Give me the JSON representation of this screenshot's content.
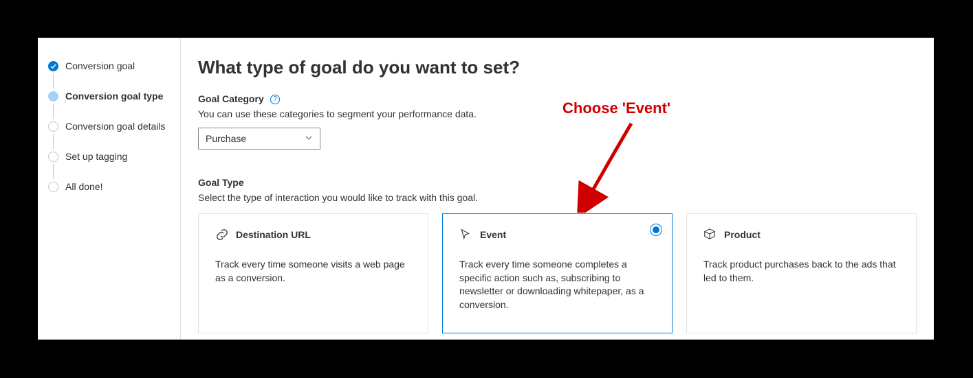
{
  "sidebar": {
    "steps": [
      {
        "label": "Conversion goal",
        "state": "done"
      },
      {
        "label": "Conversion goal type",
        "state": "active"
      },
      {
        "label": "Conversion goal details",
        "state": "todo"
      },
      {
        "label": "Set up tagging",
        "state": "todo"
      },
      {
        "label": "All done!",
        "state": "todo"
      }
    ]
  },
  "main": {
    "title": "What type of goal do you want to set?",
    "category": {
      "label": "Goal Category",
      "desc": "You can use these categories to segment your performance data.",
      "selected": "Purchase"
    },
    "goal_type": {
      "label": "Goal Type",
      "desc": "Select the type of interaction you would like to track with this goal.",
      "cards": [
        {
          "title": "Destination URL",
          "desc": "Track every time someone visits a web page as a conversion.",
          "selected": false
        },
        {
          "title": "Event",
          "desc": "Track every time someone completes a specific action such as, subscribing to newsletter or downloading whitepaper, as a conversion.",
          "selected": true
        },
        {
          "title": "Product",
          "desc": "Track product purchases back to the ads that led to them.",
          "selected": false
        }
      ]
    }
  },
  "annotation": {
    "text": "Choose 'Event'"
  }
}
